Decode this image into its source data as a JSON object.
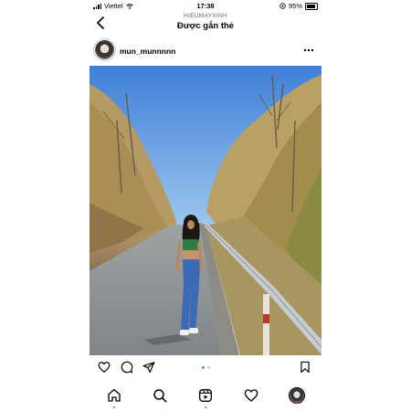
{
  "status_bar": {
    "carrier": "Viettel",
    "time": "17:38",
    "battery": "95%"
  },
  "header": {
    "subtitle": "HIEUMAYXINH",
    "title": "Được gắn thẻ"
  },
  "post": {
    "username": "mun_munnnnn",
    "carousel_total": 2,
    "carousel_active": 1
  },
  "icons": {
    "back": "chevron-left-icon",
    "more": "more-icon",
    "like": "heart-icon",
    "comment": "comment-icon",
    "share": "send-icon",
    "save": "bookmark-icon",
    "home": "home-icon",
    "search": "search-icon",
    "reels": "reels-icon",
    "activity": "heart-icon"
  },
  "colors": {
    "accent": "#3897f0",
    "notification": "#ed4956"
  }
}
